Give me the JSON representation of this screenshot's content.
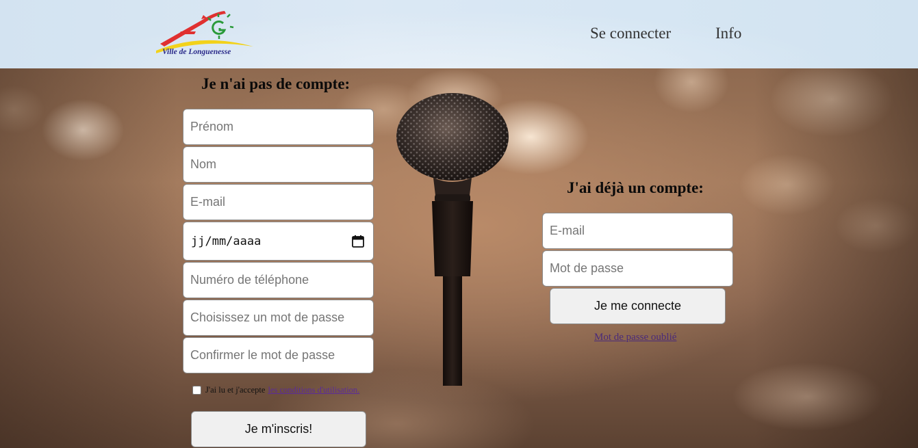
{
  "header": {
    "logo_text": "Ville de Longuenesse",
    "nav": {
      "login_label": "Se connecter",
      "info_label": "Info"
    }
  },
  "signup": {
    "title": "Je n'ai pas de compte:",
    "fields": {
      "first_name_placeholder": "Prénom",
      "last_name_placeholder": "Nom",
      "email_placeholder": "E-mail",
      "birthdate_placeholder": "jj/mm/aaaa",
      "phone_placeholder": "Numéro de téléphone",
      "password_placeholder": "Choisissez un mot de passe",
      "confirm_password_placeholder": "Confirmer le mot de passe"
    },
    "terms": {
      "checked": false,
      "text": "J'ai lu et j'accepte",
      "link_text": "les conditions d'utilisation."
    },
    "submit_label": "Je m'inscris!"
  },
  "login": {
    "title": "J'ai déjà un compte:",
    "fields": {
      "email_placeholder": "E-mail",
      "password_placeholder": "Mot de passe"
    },
    "submit_label": "Je me connecte",
    "forgot_label": "Mot de passe oublié"
  },
  "icons": {
    "calendar": "calendar-icon",
    "logo": "city-logo"
  },
  "colors": {
    "header_bg": "#d3e3f1",
    "link_visited": "#5a2a9a",
    "button_bg": "#f0f0f0"
  }
}
